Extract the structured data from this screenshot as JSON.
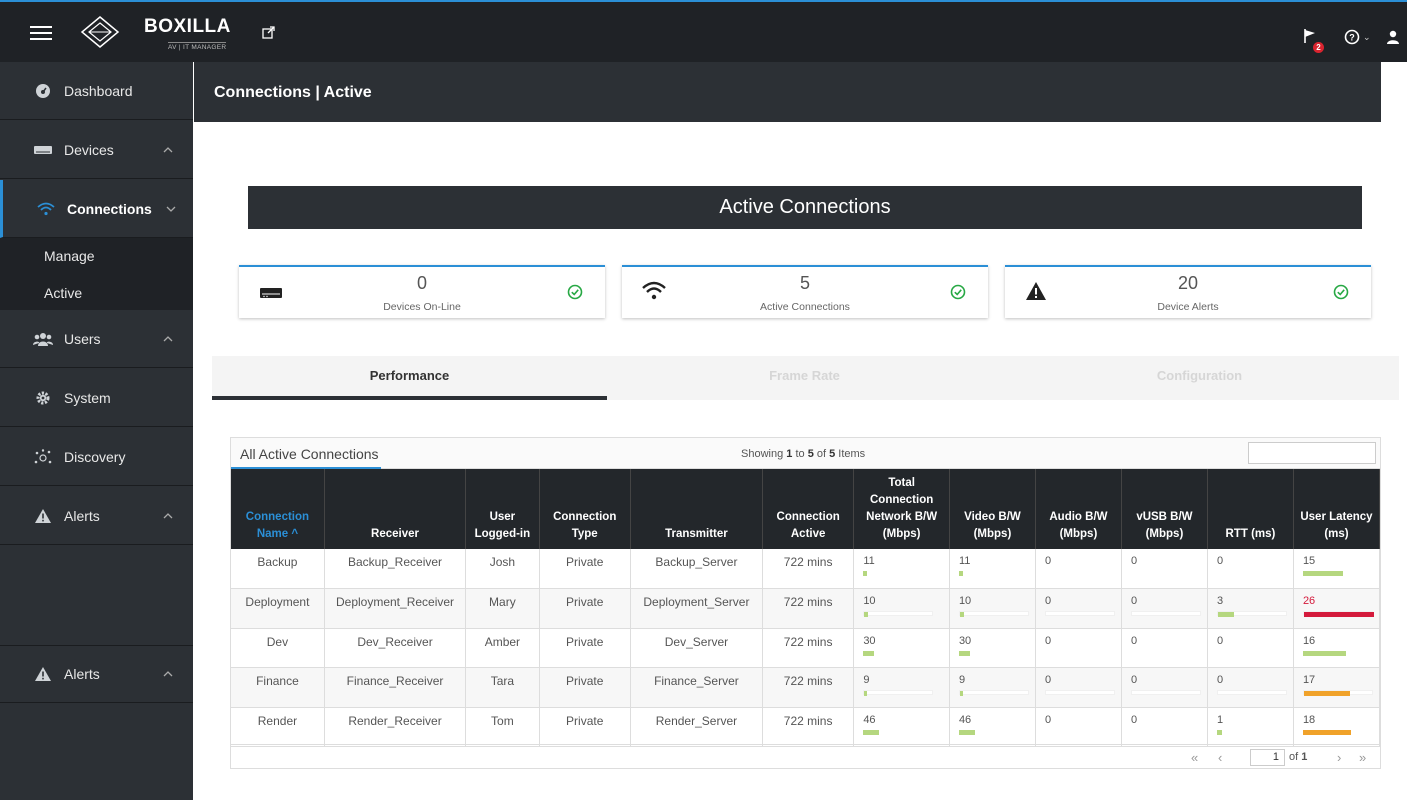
{
  "topbar": {
    "brand": "BOXILLA",
    "brand_sub": "AV | IT MANAGER",
    "alert_badge": "2"
  },
  "sidebar": {
    "items": [
      {
        "label": "Dashboard"
      },
      {
        "label": "Devices"
      },
      {
        "label": "Connections"
      },
      {
        "label": "Users"
      },
      {
        "label": "System"
      },
      {
        "label": "Discovery"
      },
      {
        "label": "Alerts"
      },
      {
        "label": "Alerts"
      }
    ],
    "sub_items": [
      {
        "label": "Manage"
      },
      {
        "label": "Active"
      }
    ]
  },
  "page": {
    "title": "Connections | Active",
    "banner": "Active Connections"
  },
  "cards": [
    {
      "value": "0",
      "label": "Devices On-Line"
    },
    {
      "value": "5",
      "label": "Active Connections"
    },
    {
      "value": "20",
      "label": "Device Alerts"
    }
  ],
  "tabs": [
    {
      "label": "Performance",
      "active": true
    },
    {
      "label": "Frame Rate",
      "active": false
    },
    {
      "label": "Configuration",
      "active": false
    }
  ],
  "table": {
    "title": "All Active Connections",
    "showing_prefix": "Showing ",
    "showing_from": "1",
    "showing_to_word": " to ",
    "showing_to": "5",
    "showing_of_word": " of ",
    "showing_total": "5",
    "showing_suffix": " Items",
    "headers": [
      "Connection Name ^",
      "Receiver",
      "User Logged-in",
      "Connection Type",
      "Transmitter",
      "Connection Active",
      "Total Connection Network B/W (Mbps)",
      "Video B/W (Mbps)",
      "Audio B/W (Mbps)",
      "vUSB B/W (Mbps)",
      "RTT (ms)",
      "User Latency (ms)"
    ],
    "rows": [
      {
        "name": "Backup",
        "receiver": "Backup_Receiver",
        "user": "Josh",
        "type": "Private",
        "transmitter": "Backup_Server",
        "active": "722 mins",
        "total_bw": 11,
        "video_bw": 11,
        "audio_bw": 0,
        "vusb_bw": 0,
        "rtt": 0,
        "latency": 15
      },
      {
        "name": "Deployment",
        "receiver": "Deployment_Receiver",
        "user": "Mary",
        "type": "Private",
        "transmitter": "Deployment_Server",
        "active": "722 mins",
        "total_bw": 10,
        "video_bw": 10,
        "audio_bw": 0,
        "vusb_bw": 0,
        "rtt": 3,
        "latency": 26
      },
      {
        "name": "Dev",
        "receiver": "Dev_Receiver",
        "user": "Amber",
        "type": "Private",
        "transmitter": "Dev_Server",
        "active": "722 mins",
        "total_bw": 30,
        "video_bw": 30,
        "audio_bw": 0,
        "vusb_bw": 0,
        "rtt": 0,
        "latency": 16
      },
      {
        "name": "Finance",
        "receiver": "Finance_Receiver",
        "user": "Tara",
        "type": "Private",
        "transmitter": "Finance_Server",
        "active": "722 mins",
        "total_bw": 9,
        "video_bw": 9,
        "audio_bw": 0,
        "vusb_bw": 0,
        "rtt": 0,
        "latency": 17
      },
      {
        "name": "Render",
        "receiver": "Render_Receiver",
        "user": "Tom",
        "type": "Private",
        "transmitter": "Render_Server",
        "active": "722 mins",
        "total_bw": 46,
        "video_bw": 46,
        "audio_bw": 0,
        "vusb_bw": 0,
        "rtt": 1,
        "latency": 18
      }
    ],
    "pager": {
      "page": "1",
      "of_word": "of ",
      "total_pages": "1"
    }
  },
  "colors": {
    "accent": "#2b8fd6",
    "bar_green": "#b5d77f",
    "bar_orange": "#f0a22a",
    "bar_red": "#d41a3c",
    "check_green": "#27a844"
  }
}
